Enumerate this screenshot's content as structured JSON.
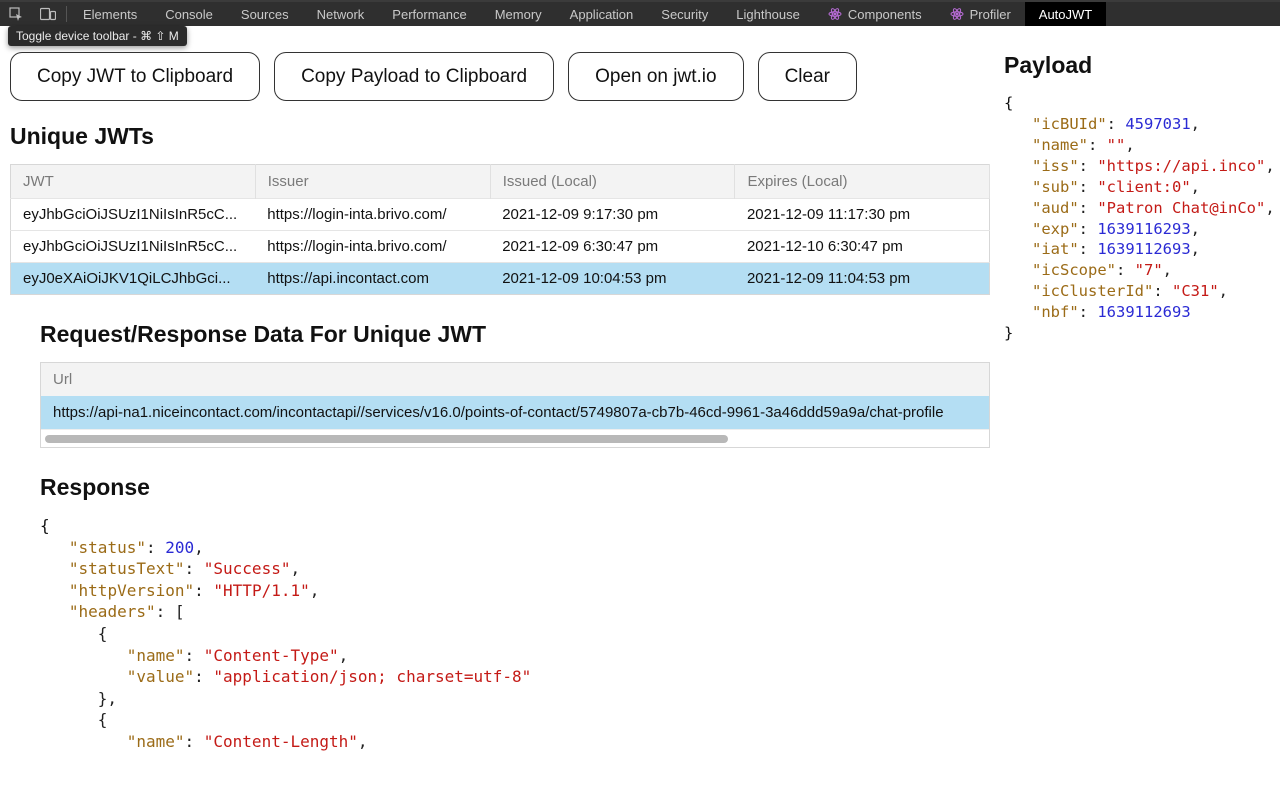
{
  "devtools": {
    "tooltip": "Toggle device toolbar - ⌘ ⇧ M",
    "tabs": [
      "Elements",
      "Console",
      "Sources",
      "Network",
      "Performance",
      "Memory",
      "Application",
      "Security",
      "Lighthouse"
    ],
    "react_tabs": [
      "Components",
      "Profiler"
    ],
    "active_tab": "AutoJWT"
  },
  "buttons": {
    "copy_jwt": "Copy JWT to Clipboard",
    "copy_payload": "Copy Payload to Clipboard",
    "open_jwtio": "Open on jwt.io",
    "clear": "Clear"
  },
  "headings": {
    "unique_jwts": "Unique JWTs",
    "request_response": "Request/Response Data For Unique JWT",
    "response": "Response",
    "payload": "Payload"
  },
  "jwt_table": {
    "headers": [
      "JWT",
      "Issuer",
      "Issued (Local)",
      "Expires (Local)"
    ],
    "rows": [
      {
        "jwt": "eyJhbGciOiJSUzI1NiIsInR5cC...",
        "issuer": "https://login-inta.brivo.com/",
        "issued": "2021-12-09 9:17:30 pm",
        "expires": "2021-12-09 11:17:30 pm",
        "selected": false
      },
      {
        "jwt": "eyJhbGciOiJSUzI1NiIsInR5cC...",
        "issuer": "https://login-inta.brivo.com/",
        "issued": "2021-12-09 6:30:47 pm",
        "expires": "2021-12-10 6:30:47 pm",
        "selected": false
      },
      {
        "jwt": "eyJ0eXAiOiJKV1QiLCJhbGci...",
        "issuer": "https://api.incontact.com",
        "issued": "2021-12-09 10:04:53 pm",
        "expires": "2021-12-09 11:04:53 pm",
        "selected": true
      }
    ]
  },
  "url_table": {
    "header": "Url",
    "value": "https://api-na1.niceincontact.com/incontactapi//services/v16.0/points-of-contact/5749807a-cb7b-46cd-9961-3a46ddd59a9a/chat-profile"
  },
  "response_json": {
    "status": 200,
    "statusText": "Success",
    "httpVersion": "HTTP/1.1",
    "headers": [
      {
        "name": "Content-Type",
        "value": "application/json; charset=utf-8"
      },
      {
        "name": "Content-Length"
      }
    ]
  },
  "payload_json": {
    "icBUId": 4597031,
    "name": "",
    "iss": "https://api.inco",
    "sub": "client:0",
    "aud": "Patron Chat@inCo",
    "exp": 1639116293,
    "iat": 1639112693,
    "icScope": "7",
    "icClusterId": "C31",
    "nbf": 1639112693
  }
}
